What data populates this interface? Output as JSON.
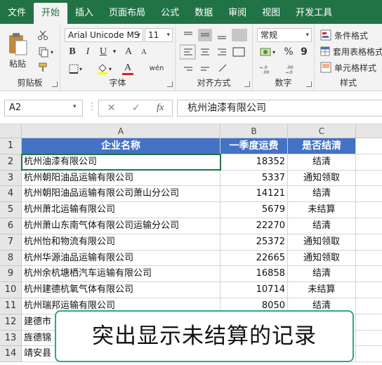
{
  "tabs": [
    "文件",
    "开始",
    "插入",
    "页面布局",
    "公式",
    "数据",
    "审阅",
    "视图",
    "开发工具"
  ],
  "active_tab": "开始",
  "clipboard": {
    "paste_label": "粘贴",
    "group_label": "剪贴板"
  },
  "font": {
    "font_name": "Arial Unicode MS",
    "font_size": "11",
    "bold": "B",
    "italic": "I",
    "underline": "U",
    "grow": "A",
    "shrink": "A",
    "wen": "wén",
    "group_label": "字体"
  },
  "alignment": {
    "group_label": "对齐方式"
  },
  "number": {
    "format": "常规",
    "percent": "%",
    "comma": "9",
    "group_label": "数字"
  },
  "styles": {
    "conditional": "条件格式",
    "table": "套用表格格式",
    "cell": "单元格样式",
    "group_label": "样式"
  },
  "namebox": "A2",
  "fx_label": "fx",
  "formula": "杭州油漆有限公司",
  "columns": [
    "A",
    "B",
    "C"
  ],
  "headers": [
    "企业名称",
    "一季度运费",
    "是否结清"
  ],
  "rows": [
    [
      "杭州油漆有限公司",
      "18352",
      "结清"
    ],
    [
      "杭州朝阳油品运输有限公司",
      "5337",
      "通知领取"
    ],
    [
      "杭州朝阳油品运输有限公司萧山分公司",
      "14121",
      "结清"
    ],
    [
      "杭州萧北运输有限公司",
      "5679",
      "未结算"
    ],
    [
      "杭州萧山东南气体有限公司运输分公司",
      "22270",
      "结清"
    ],
    [
      "杭州怡和物流有限公司",
      "25372",
      "通知领取"
    ],
    [
      "杭州华源油品运输有限公司",
      "22665",
      "通知领取"
    ],
    [
      "杭州余杭塘栖汽车运输有限公司",
      "16858",
      "结清"
    ],
    [
      "杭州建德杭氧气体有限公司",
      "10714",
      "未结算"
    ],
    [
      "杭州瑞邦运输有限公司",
      "8050",
      "结清"
    ],
    [
      "建德市",
      "",
      ""
    ],
    [
      "旌德锦",
      "",
      ""
    ],
    [
      "靖安县",
      "",
      ""
    ]
  ],
  "row_numbers": [
    "1",
    "2",
    "3",
    "4",
    "5",
    "6",
    "7",
    "8",
    "9",
    "10",
    "11",
    "12",
    "13",
    "14"
  ],
  "caption": "突出显示未结算的记录"
}
